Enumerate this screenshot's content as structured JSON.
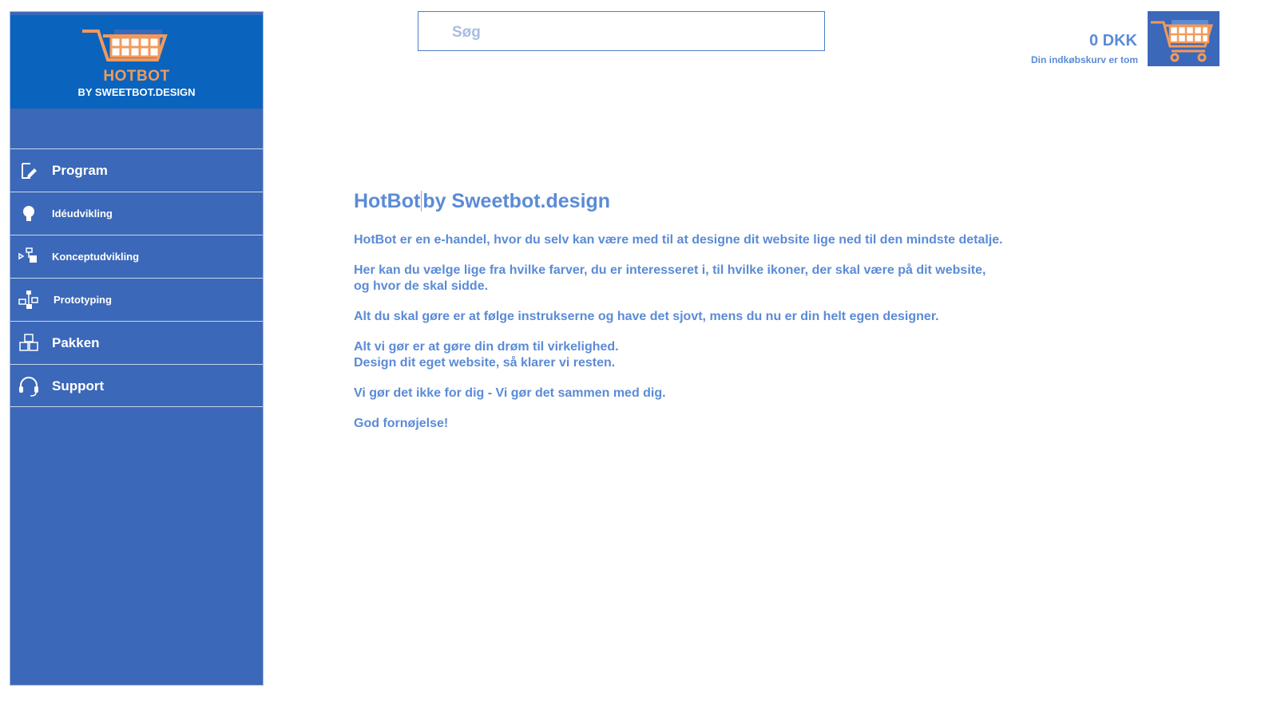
{
  "brand": {
    "logo_word": "HOTBOT",
    "logo_sub": "BY SWEETBOT.DESIGN",
    "colors": {
      "sidebar": "#3b68b8",
      "logo_bg": "#0a64bd",
      "accent": "#f29a5c",
      "text": "#5b8bd6"
    }
  },
  "sidebar": {
    "items": [
      {
        "label": "Program",
        "icon": "edit-icon"
      },
      {
        "label": "Idéudvikling",
        "icon": "lightbulb-icon"
      },
      {
        "label": "Konceptudvikling",
        "icon": "concept-flow-icon"
      },
      {
        "label": "Prototyping",
        "icon": "prototype-network-icon"
      },
      {
        "label": "Pakken",
        "icon": "boxes-icon"
      },
      {
        "label": "Support",
        "icon": "headset-icon"
      }
    ]
  },
  "search": {
    "placeholder": "Søg",
    "value": ""
  },
  "cart": {
    "total": "0 DKK",
    "status": "Din indkøbskurv er tom",
    "icon": "shopping-cart-icon"
  },
  "content": {
    "title_part1": "HotBot",
    "title_part2": "by Sweetbot.design",
    "p1": "HotBot er en e-handel, hvor du selv kan være med til at designe dit website lige ned til den mindste detalje.",
    "p2_line1": "Her kan du vælge lige fra hvilke farver, du er interesseret i, til hvilke ikoner, der skal være på dit website,",
    "p2_line2": "og hvor de skal sidde.",
    "p3": "Alt du skal gøre er at følge instrukserne og have det sjovt, mens du nu er din helt egen designer.",
    "p4_line1": "Alt vi gør er at gøre din drøm til virkelighed.",
    "p4_line2": "Design dit eget website, så klarer vi resten.",
    "p5": "Vi gør det ikke for dig - Vi gør det sammen med dig.",
    "p6": "God fornøjelse!"
  }
}
